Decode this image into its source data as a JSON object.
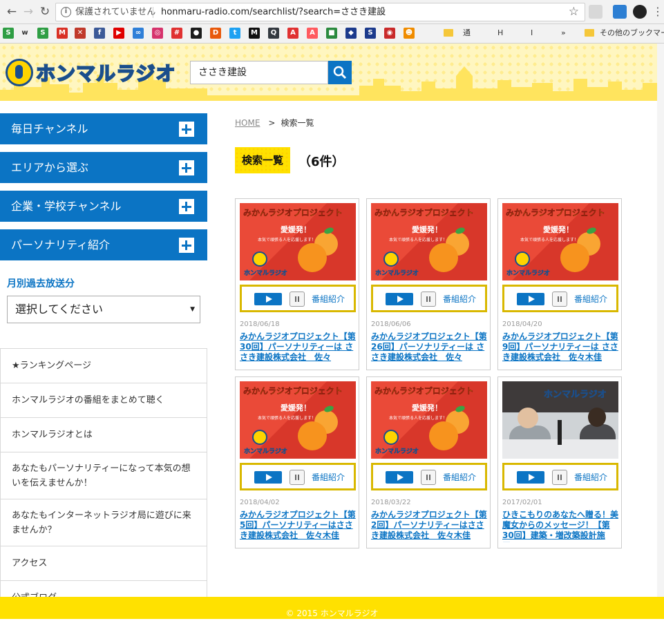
{
  "browser": {
    "security_label": "保護されていません",
    "url": "honmaru-radio.com/searchlist/?search=ささき建設",
    "other_bookmarks": "その他のブックマーク"
  },
  "bookmarks": [
    {
      "icon": "s-icon",
      "color": "#2f9e44",
      "text": "S"
    },
    {
      "icon": "w-icon",
      "color": "#f2f2f2",
      "text": "w"
    },
    {
      "icon": "s2-icon",
      "color": "#2f9e44",
      "text": "S"
    },
    {
      "icon": "gmail-icon",
      "color": "#d93025",
      "text": "M"
    },
    {
      "icon": "x-icon",
      "color": "#c0392b",
      "text": "✕"
    },
    {
      "icon": "facebook-icon",
      "color": "#3b5998",
      "text": "f"
    },
    {
      "icon": "youtube-icon",
      "color": "#e00000",
      "text": "▶"
    },
    {
      "icon": "infinity-icon",
      "color": "#2f7fd8",
      "text": "∞"
    },
    {
      "icon": "instagram-icon",
      "color": "#d6336c",
      "text": "◎"
    },
    {
      "icon": "hashtag-icon",
      "color": "#e03131",
      "text": "#"
    },
    {
      "icon": "app-icon",
      "color": "#1c1c1c",
      "text": "●"
    },
    {
      "icon": "d-icon",
      "color": "#e8590c",
      "text": "D"
    },
    {
      "icon": "twitter-icon",
      "color": "#1da1f2",
      "text": "t"
    },
    {
      "icon": "m-icon",
      "color": "#111",
      "text": "M"
    },
    {
      "icon": "search-icon",
      "color": "#343a40",
      "text": "Q"
    },
    {
      "icon": "adobe-icon",
      "color": "#e03131",
      "text": "A"
    },
    {
      "icon": "airbnb-icon",
      "color": "#ff5a5f",
      "text": "A"
    },
    {
      "icon": "card-icon",
      "color": "#2b8a3e",
      "text": "■"
    },
    {
      "icon": "ticket-icon",
      "color": "#1c3a8c",
      "text": "◆"
    },
    {
      "icon": "sbi-icon",
      "color": "#1c3a8c",
      "text": "S"
    },
    {
      "icon": "camera-icon",
      "color": "#c92a2a",
      "text": "◉"
    },
    {
      "icon": "dog-icon",
      "color": "#f08c00",
      "text": "☻"
    }
  ],
  "bookmark_folders": [
    "",
    "通",
    "H",
    "I"
  ],
  "site": {
    "logo_text": "ホンマルラジオ",
    "search_value": "ささき建設"
  },
  "sidebar": {
    "menu": [
      {
        "label": "毎日チャンネル"
      },
      {
        "label": "エリアから選ぶ"
      },
      {
        "label": "企業・学校チャンネル"
      },
      {
        "label": "パーソナリティ紹介"
      }
    ],
    "archive_title": "月別過去放送分",
    "archive_select": "選択してください",
    "links": [
      "★ランキングページ",
      "ホンマルラジオの番組をまとめて聴く",
      "ホンマルラジオとは",
      "あなたもパーソナリティーになって本気の想いを伝えませんか！",
      "あなたもインターネットラジオ局に遊びに来ませんか？",
      "アクセス",
      "公式ブログ"
    ]
  },
  "main": {
    "breadcrumb_home": "HOME",
    "breadcrumb_current": "検索一覧",
    "results_label": "検索一覧",
    "results_count": "（6件）",
    "program_label": "番組紹介",
    "cards": [
      {
        "date": "2018/06/18",
        "title": "みかんラジオプロジェクト【第30回】パーソナリティーは ささき建設株式会社　佐々",
        "thumb": "mikan"
      },
      {
        "date": "2018/06/06",
        "title": "みかんラジオプロジェクト【第26回】パーソナリティーは ささき建設株式会社　佐々",
        "thumb": "mikan"
      },
      {
        "date": "2018/04/20",
        "title": "みかんラジオプロジェクト【第9回】パーソナリティーは ささき建設株式会社　佐々木佳",
        "thumb": "mikan"
      },
      {
        "date": "2018/04/02",
        "title": "みかんラジオプロジェクト【第5回】パーソナリティーはささき建設株式会社　佐々木佳",
        "thumb": "mikan"
      },
      {
        "date": "2018/03/22",
        "title": "みかんラジオプロジェクト【第2回】パーソナリティーはささき建設株式会社　佐々木佳",
        "thumb": "mikan"
      },
      {
        "date": "2017/02/01",
        "title": "ひきこもりのあなたへ贈る！美魔女からのメッセージ！【第30回】建築・増改築設計施工・",
        "thumb": "studio"
      }
    ],
    "thumb_text": {
      "title": "みかんラジオプロジェクト",
      "sub": "愛媛発！",
      "tiny": "本気で頑張る人を応援します！",
      "logo": "ホンマルラジオ"
    }
  },
  "footer": {
    "copyright": "© 2015 ホンマルラジオ"
  }
}
